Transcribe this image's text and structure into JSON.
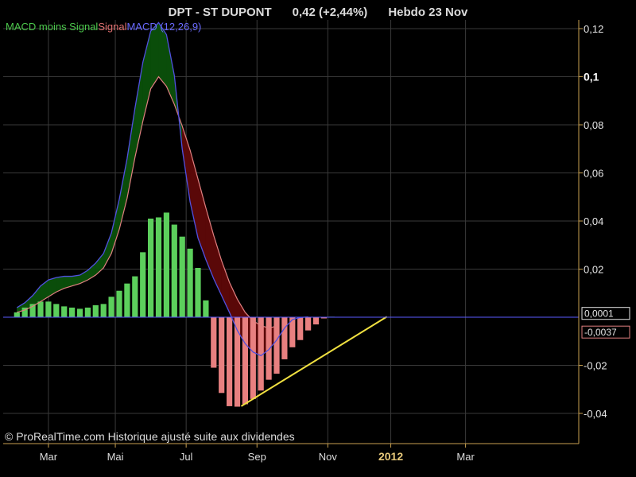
{
  "header": {
    "title": "DPT - ST DUPONT",
    "quote": "0,42 (+2,44%)",
    "period": "Hebdo  23 Nov"
  },
  "legend": {
    "histogram": "MACD moins Signal",
    "signal": "Signal",
    "macd": "MACD (12,26,9)"
  },
  "credit": "© ProRealTime.com Historique ajusté suite aux dividendes",
  "colors": {
    "background": "#000000",
    "hist_positive": "#5ccf5c",
    "hist_negative": "#e88080",
    "macd_line": "#5050e0",
    "signal_line": "#e08080",
    "fill_positive": "#0a4d0a",
    "fill_negative": "#5a0808",
    "trendline": "#f0e040",
    "axis": "#c8a050"
  },
  "chart_data": {
    "type": "bar",
    "title": "DPT - ST DUPONT",
    "ylim": [
      -0.051,
      0.1255
    ],
    "y_ticks": [
      {
        "value": 0.12,
        "label": "0,12",
        "bold": false
      },
      {
        "value": 0.1,
        "label": "0,1",
        "bold": true
      },
      {
        "value": 0.08,
        "label": "0,08",
        "bold": false
      },
      {
        "value": 0.06,
        "label": "0,06",
        "bold": false
      },
      {
        "value": 0.04,
        "label": "0,04",
        "bold": false
      },
      {
        "value": 0.02,
        "label": "0,02",
        "bold": false
      },
      {
        "value": -0.02,
        "label": "-0,02",
        "bold": false
      },
      {
        "value": -0.04,
        "label": "-0,04",
        "bold": false
      }
    ],
    "x_ticks": [
      {
        "week": 5,
        "label": "Mar",
        "bold": false
      },
      {
        "week": 13.5,
        "label": "Mai",
        "bold": false
      },
      {
        "week": 22.5,
        "label": "Jul",
        "bold": false
      },
      {
        "week": 31.5,
        "label": "Sep",
        "bold": false
      },
      {
        "week": 40.5,
        "label": "Nov",
        "bold": false
      },
      {
        "week": 48.5,
        "label": "2012",
        "bold": true
      },
      {
        "week": 58,
        "label": "Mar",
        "bold": false
      }
    ],
    "weeks": [
      1,
      2,
      3,
      4,
      5,
      6,
      7,
      8,
      9,
      10,
      11,
      12,
      13,
      14,
      15,
      16,
      17,
      18,
      19,
      20,
      21,
      22,
      23,
      24,
      25,
      26,
      27,
      28,
      29,
      30,
      31,
      32,
      33,
      34,
      35,
      36,
      37,
      38,
      39,
      40,
      41
    ],
    "histogram": [
      0.002,
      0.004,
      0.0055,
      0.0065,
      0.0065,
      0.0055,
      0.0045,
      0.004,
      0.0035,
      0.004,
      0.005,
      0.0055,
      0.0085,
      0.011,
      0.014,
      0.017,
      0.027,
      0.041,
      0.0415,
      0.0435,
      0.0385,
      0.0335,
      0.0285,
      0.0205,
      0.007,
      -0.021,
      -0.0315,
      -0.037,
      -0.0372,
      -0.0362,
      -0.034,
      -0.0305,
      -0.026,
      -0.0235,
      -0.0175,
      -0.0125,
      -0.0095,
      -0.0055,
      -0.003,
      -0.0005,
      0.0002
    ],
    "macd": [
      0.004,
      0.006,
      0.009,
      0.013,
      0.0155,
      0.0165,
      0.017,
      0.017,
      0.0175,
      0.0195,
      0.0225,
      0.0265,
      0.035,
      0.049,
      0.066,
      0.087,
      0.106,
      0.119,
      0.1225,
      0.1175,
      0.1005,
      0.07,
      0.048,
      0.033,
      0.024,
      0.016,
      0.009,
      0.002,
      -0.0055,
      -0.011,
      -0.0145,
      -0.016,
      -0.0135,
      -0.0095,
      -0.0045,
      -0.001,
      -0.0001,
      0.0001
    ],
    "signal": [
      0.002,
      0.003,
      0.0045,
      0.0065,
      0.0085,
      0.0105,
      0.012,
      0.013,
      0.014,
      0.0155,
      0.0175,
      0.0205,
      0.0265,
      0.0365,
      0.0495,
      0.0665,
      0.0815,
      0.095,
      0.1,
      0.096,
      0.0885,
      0.0795,
      0.0695,
      0.0575,
      0.0455,
      0.034,
      0.0235,
      0.0145,
      0.0075,
      0.002,
      -0.0015,
      -0.0035,
      -0.0045,
      -0.0037
    ],
    "trendline": {
      "from": [
        29.5,
        -0.037
      ],
      "to": [
        48,
        0.0002
      ]
    },
    "current_values": [
      {
        "label": "0,0001",
        "value": 0.0001
      },
      {
        "label": "-0,0037",
        "value": -0.0037
      }
    ]
  }
}
